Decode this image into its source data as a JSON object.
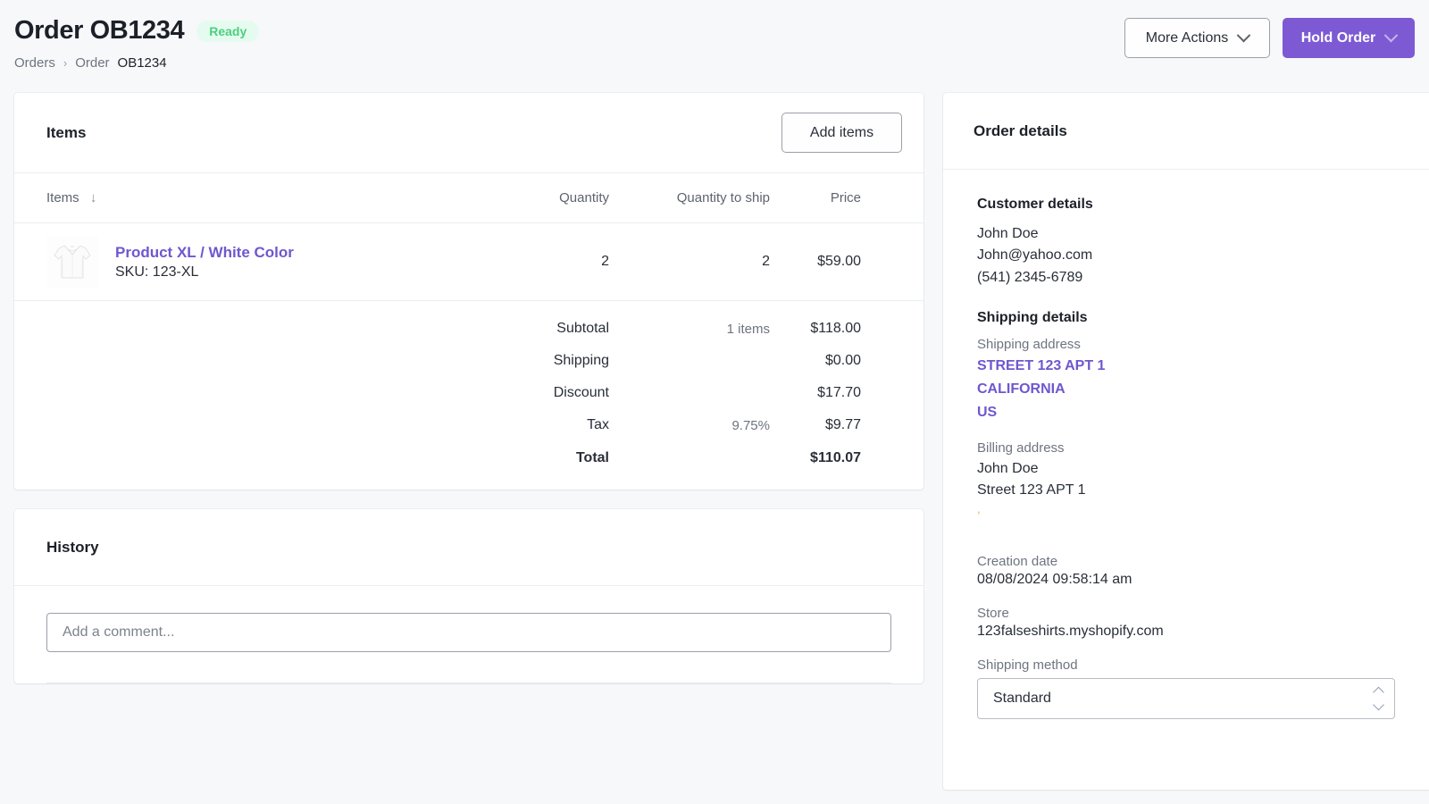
{
  "header": {
    "title": "Order OB1234",
    "status": "Ready",
    "breadcrumb": {
      "root": "Orders",
      "separator": "›",
      "parent": "Order",
      "current": "OB1234"
    },
    "actions": {
      "more_actions": "More Actions",
      "hold_order": "Hold Order"
    }
  },
  "items_card": {
    "title": "Items",
    "add_items_label": "Add items",
    "columns": {
      "item": "Items",
      "sort_arrow": "↓",
      "quantity": "Quantity",
      "quantity_to_ship": "Quantity to ship",
      "price": "Price"
    },
    "rows": [
      {
        "name": "Product XL / White Color",
        "sku": "SKU: 123-XL",
        "quantity": "2",
        "quantity_to_ship": "2",
        "price": "$59.00"
      }
    ],
    "totals": [
      {
        "label": "Subtotal",
        "note": "1 items",
        "value": "$118.00"
      },
      {
        "label": "Shipping",
        "note": "",
        "value": "$0.00"
      },
      {
        "label": "Discount",
        "note": "",
        "value": "$17.70"
      },
      {
        "label": "Tax",
        "note": "9.75%",
        "value": "$9.77"
      },
      {
        "label": "Total",
        "note": "",
        "value": "$110.07"
      }
    ]
  },
  "history_card": {
    "title": "History",
    "comment_placeholder": "Add a comment..."
  },
  "order_details": {
    "title": "Order details",
    "customer": {
      "heading": "Customer details",
      "name": "John Doe",
      "email": "John@yahoo.com",
      "phone": "(541) 2345-6789"
    },
    "shipping": {
      "heading": "Shipping details",
      "address_label": "Shipping address",
      "address_lines": [
        "STREET 123 APT 1",
        "CALIFORNIA",
        "US"
      ],
      "billing_label": "Billing address",
      "billing_lines": [
        "John Doe",
        "Street 123 APT 1"
      ],
      "billing_trailing_mark": ","
    },
    "creation_date_label": "Creation date",
    "creation_date_value": "08/08/2024 09:58:14 am",
    "store_label": "Store",
    "store_value": "123falseshirts.myshopify.com",
    "shipping_method_label": "Shipping method",
    "shipping_method_value": "Standard",
    "shipping_method_options": [
      "Standard"
    ]
  },
  "colors": {
    "accent_purple": "#7d5ad4",
    "link_purple": "#6f57cf",
    "status_green_text": "#4ad07f",
    "status_green_bg": "#e6fbef",
    "page_bg": "#f7f8fa"
  }
}
